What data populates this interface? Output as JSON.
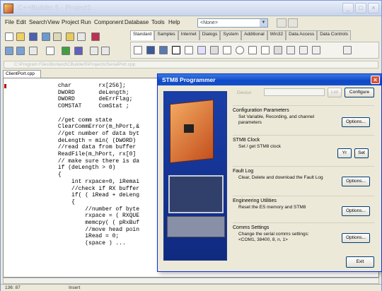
{
  "window": {
    "title": "C++Builder 5 - Project1",
    "min": "_",
    "max": "□",
    "close": "×"
  },
  "menu": [
    "File",
    "Edit",
    "Search",
    "View",
    "Project",
    "Run",
    "Component",
    "Database",
    "Tools",
    "Help"
  ],
  "combo_value": "<None>",
  "palette_tabs": [
    "Standard",
    "Samples",
    "Internet",
    "Dialogs",
    "System",
    "Additional",
    "Win32",
    "Data Access",
    "Data Controls"
  ],
  "path": "C:\\Program Files\\Borland\\CBuilder5\\Projects\\SerialPort.cpp",
  "editor_tab": "ClientPort.cpp",
  "code_lines": [
    "                char        rx[256];",
    "                DWORD       deLength;",
    "                DWORD       deErrFlag;",
    "                COMSTAT     ComStat ;",
    "",
    "                //get comm state",
    "                ClearCommError(m_hPort,&",
    "                //get number of data byt",
    "                deLength = min( (DWORD)",
    "                //read data from buffer",
    "                ReadFile(m_hPort, rx[0]",
    "                // make sure there is da",
    "                if (deLength > 0)",
    "                {",
    "                    int rxpace=0, iRemai",
    "                    //check if RX buffer",
    "                    if( ( iRead + deLeng",
    "                    {",
    "                        //number of byte",
    "                        rxpace = ( RXQUE",
    "                        memcpy( ( pRxBuf",
    "                        //move head poin",
    "                        iRead = 0;",
    "                        (space ) ..."
  ],
  "status": {
    "position": "136: 87",
    "mode": "Insert"
  },
  "dialog": {
    "title": "STM8 Programmer",
    "close": "×",
    "device_label": "Device:",
    "list_button": "List",
    "configure_button": "Configure",
    "groups": [
      {
        "title": "Configuration Parameters",
        "desc": "Set Variable, Recording, and channel parameters",
        "button": "Options..."
      },
      {
        "title": "STM8 Clock",
        "desc": "Set / get STM8 clock",
        "button_a": "Yr",
        "button_b": "Set"
      },
      {
        "title": "Fault Log",
        "desc": "Clear, Delete and download the Fault Log",
        "button": "Options..."
      },
      {
        "title": "Engineering Utilities",
        "desc": "Reset the ES memory and STM8",
        "button": "Options..."
      },
      {
        "title": "Comms Settings",
        "desc": "Change the serial comms settings: <COM1, 38400, 8, n, 1>",
        "button": "Options..."
      }
    ],
    "exit_button": "Exit"
  }
}
